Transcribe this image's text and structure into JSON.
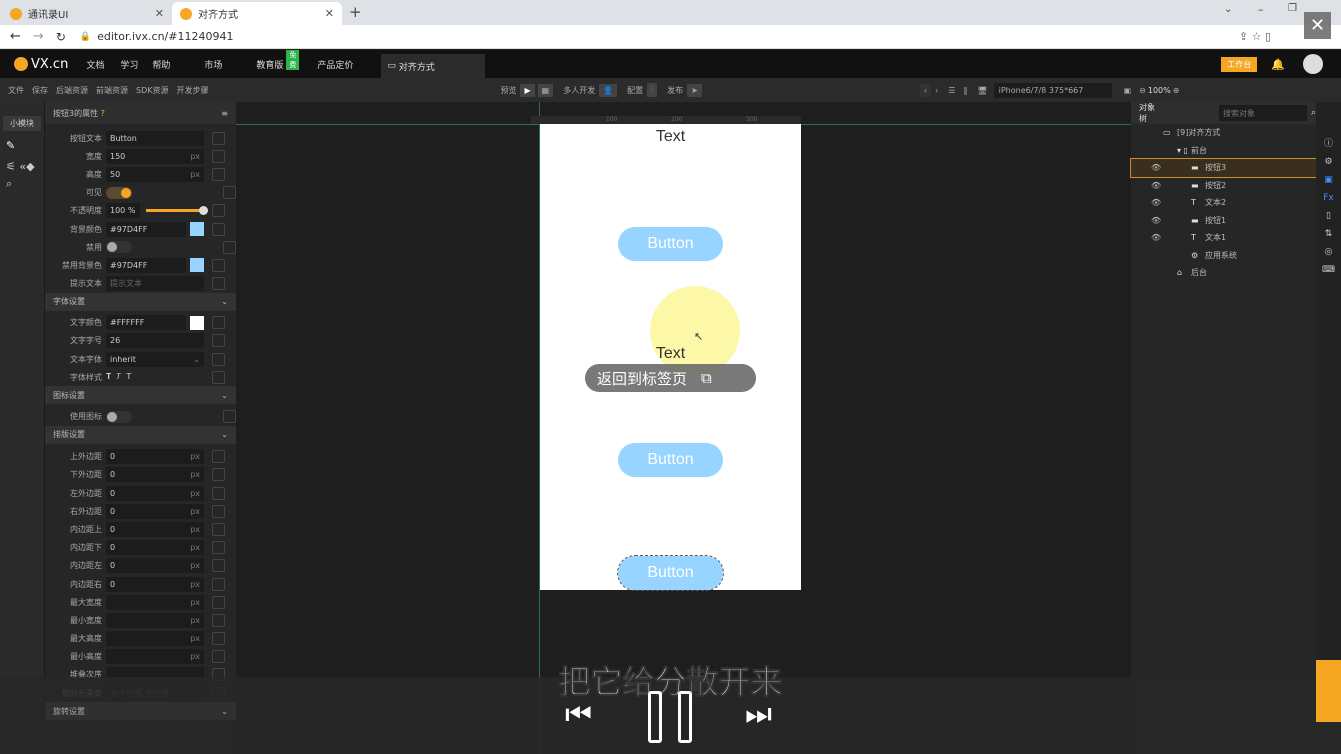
{
  "browser": {
    "tabs": [
      {
        "label": "通讯录UI"
      },
      {
        "label": "对齐方式",
        "active": true
      }
    ],
    "url": "editor.ivx.cn/#11240941"
  },
  "app": {
    "logo": "VX.cn",
    "menu": [
      "文档",
      "学习",
      "帮助",
      "市场",
      "教育版",
      "产品定价"
    ],
    "badge": "免费",
    "doc_tab": "对齐方式",
    "workbench": "工作台"
  },
  "toolbar": {
    "left": [
      "文件",
      "保存",
      "后端资源",
      "前端资源",
      "SDK资源",
      "开发步骤"
    ],
    "preview": "预览",
    "multi": "多人开发",
    "config": "配置",
    "publish": "发布",
    "device": "iPhone6/7/8 375*667",
    "zoom": "100%"
  },
  "sidebar": {
    "module": "小模块"
  },
  "props": {
    "title": "按钮3的属性",
    "rows": [
      {
        "label": "按钮文本",
        "value": "Button"
      },
      {
        "label": "宽度",
        "value": "150",
        "unit": "px"
      },
      {
        "label": "高度",
        "value": "50",
        "unit": "px"
      },
      {
        "label": "可见",
        "toggle": true
      },
      {
        "label": "不透明度",
        "value": "100 %",
        "slider": 1.0
      },
      {
        "label": "背景颜色",
        "value": "#97D4FF",
        "swatch": "#97D4FF"
      },
      {
        "label": "禁用",
        "toggle": false
      },
      {
        "label": "禁用背景色",
        "value": "#97D4FF",
        "swatch": "#97D4FF"
      },
      {
        "label": "提示文本",
        "placeholder": "提示文本"
      }
    ],
    "font_section": "字体设置",
    "font_rows": [
      {
        "label": "文字颜色",
        "value": "#FFFFFF",
        "swatch": "#FFFFFF"
      },
      {
        "label": "文字字号",
        "value": "26"
      },
      {
        "label": "文本字体",
        "value": "inherit"
      },
      {
        "label": "字体样式"
      }
    ],
    "icon_section": "图标设置",
    "icon_rows": [
      {
        "label": "使用图标",
        "toggle": false
      }
    ],
    "layout_section": "排版设置",
    "layout_rows": [
      {
        "label": "上外边距",
        "value": "0",
        "unit": "px"
      },
      {
        "label": "下外边距",
        "value": "0",
        "unit": "px"
      },
      {
        "label": "左外边距",
        "value": "0",
        "unit": "px"
      },
      {
        "label": "右外边距",
        "value": "0",
        "unit": "px"
      },
      {
        "label": "内边距上",
        "value": "0",
        "unit": "px"
      },
      {
        "label": "内边距下",
        "value": "0",
        "unit": "px"
      },
      {
        "label": "内边距左",
        "value": "0",
        "unit": "px"
      },
      {
        "label": "内边距右",
        "value": "0",
        "unit": "px"
      },
      {
        "label": "最大宽度",
        "value": "",
        "unit": "px"
      },
      {
        "label": "最小宽度",
        "value": "",
        "unit": "px"
      },
      {
        "label": "最大高度",
        "value": "",
        "unit": "px"
      },
      {
        "label": "最小高度",
        "value": "",
        "unit": "px"
      },
      {
        "label": "堆叠次序",
        "value": ""
      },
      {
        "label": "额外元素类",
        "placeholder": "多个可用,号分隔"
      }
    ],
    "rotate_section": "旋转设置"
  },
  "phone": {
    "text1": "Text",
    "button": "Button",
    "text2": "Text",
    "ruler": [
      "100",
      "200",
      "300"
    ]
  },
  "popup": {
    "label": "返回到标签页"
  },
  "tree": {
    "title": "对象树",
    "search_placeholder": "搜索对象",
    "items": [
      {
        "label": "[9]对齐方式",
        "level": 0
      },
      {
        "label": "前台",
        "level": 1
      },
      {
        "label": "按钮3",
        "level": 2,
        "eye": true,
        "selected": true
      },
      {
        "label": "按钮2",
        "level": 2,
        "eye": true
      },
      {
        "label": "文本2",
        "level": 2,
        "eye": true
      },
      {
        "label": "按钮1",
        "level": 2,
        "eye": true
      },
      {
        "label": "文本1",
        "level": 2,
        "eye": true
      },
      {
        "label": "应用系统",
        "level": 2
      },
      {
        "label": "后台",
        "level": 1
      }
    ]
  },
  "video": {
    "subtitle": "把它给分散开来"
  },
  "colors": {
    "accent": "#f5a623",
    "button_bg": "#97D4FF"
  }
}
